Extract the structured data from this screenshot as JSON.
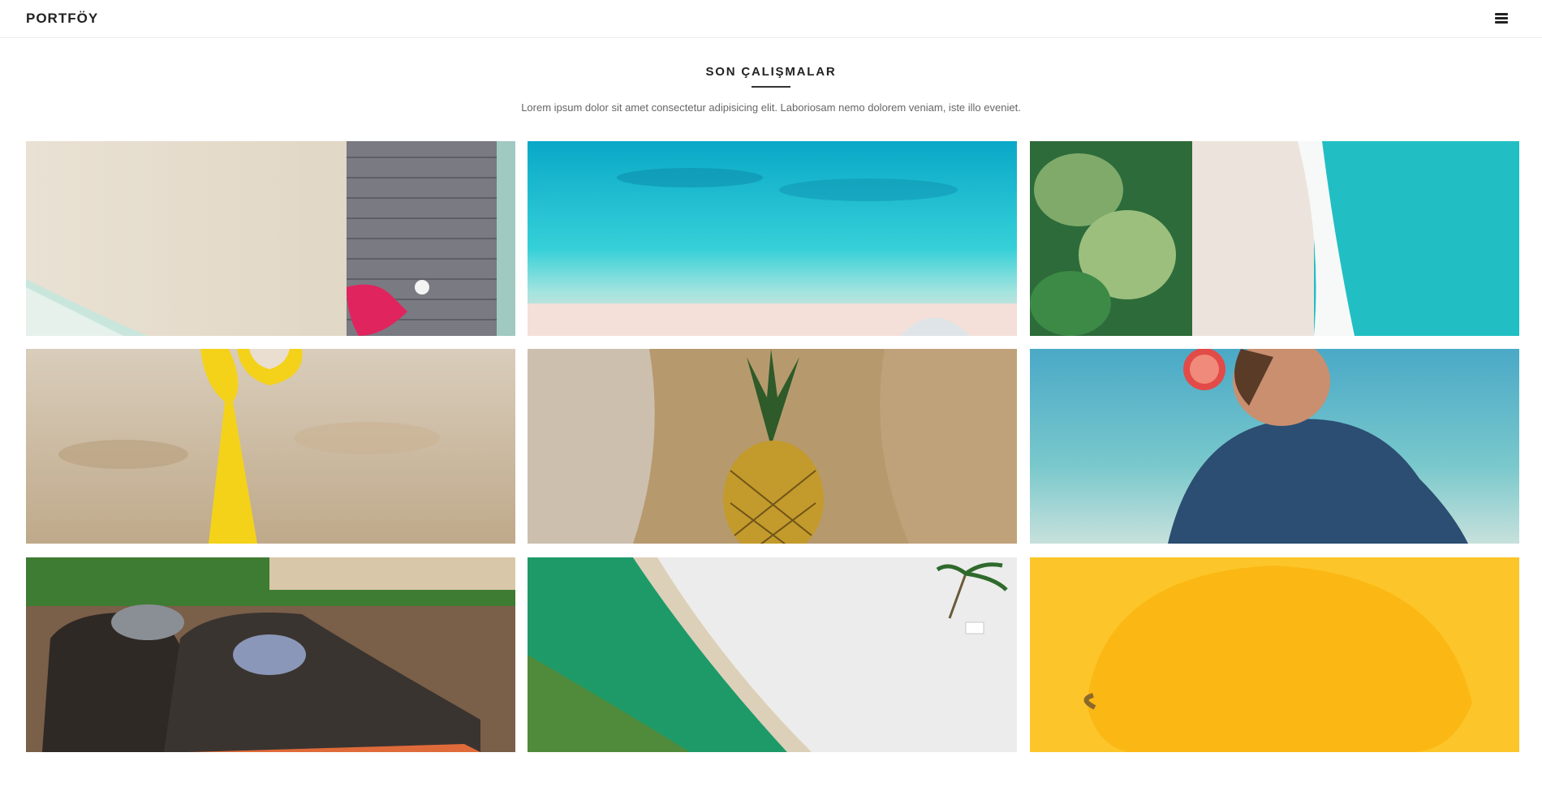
{
  "navbar": {
    "brand": "PORTFÖY"
  },
  "section": {
    "title": "SON ÇALIŞMALAR",
    "description": "Lorem ipsum dolor sit amet consectetur adipisicing elit. Laboriosam nemo dolorem veniam, iste illo eveniet."
  },
  "colors": {
    "text_dark": "#222222",
    "text_muted": "#666666",
    "border": "#ececec"
  },
  "icons": {
    "menu": "hamburger-icon"
  }
}
